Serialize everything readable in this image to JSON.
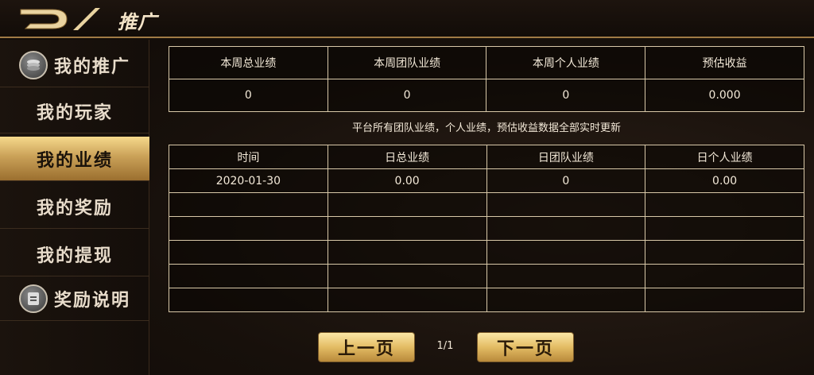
{
  "header": {
    "title": "推广",
    "back_icon": "back-arrow-icon"
  },
  "sidebar": {
    "items": [
      {
        "label": "我的推广",
        "icon": "coin-stack-icon",
        "active": false
      },
      {
        "label": "我的玩家",
        "active": false
      },
      {
        "label": "我的业绩",
        "active": true
      },
      {
        "label": "我的奖励",
        "active": false
      },
      {
        "label": "我的提现",
        "active": false
      },
      {
        "label": "奖励说明",
        "icon": "document-icon",
        "active": false
      }
    ]
  },
  "summary": {
    "headers": [
      "本周总业绩",
      "本周团队业绩",
      "本周个人业绩",
      "预估收益"
    ],
    "values": [
      "0",
      "0",
      "0",
      "0.000"
    ]
  },
  "note": "平台所有团队业绩，个人业绩，预估收益数据全部实时更新",
  "daily": {
    "headers": [
      "时间",
      "日总业绩",
      "日团队业绩",
      "日个人业绩"
    ],
    "rows": [
      [
        "2020-01-30",
        "0.00",
        "0",
        "0.00"
      ],
      [
        "",
        "",
        "",
        ""
      ],
      [
        "",
        "",
        "",
        ""
      ],
      [
        "",
        "",
        "",
        ""
      ],
      [
        "",
        "",
        "",
        ""
      ],
      [
        "",
        "",
        "",
        ""
      ]
    ]
  },
  "pager": {
    "prev_label": "上一页",
    "next_label": "下一页",
    "page": "1/1"
  }
}
